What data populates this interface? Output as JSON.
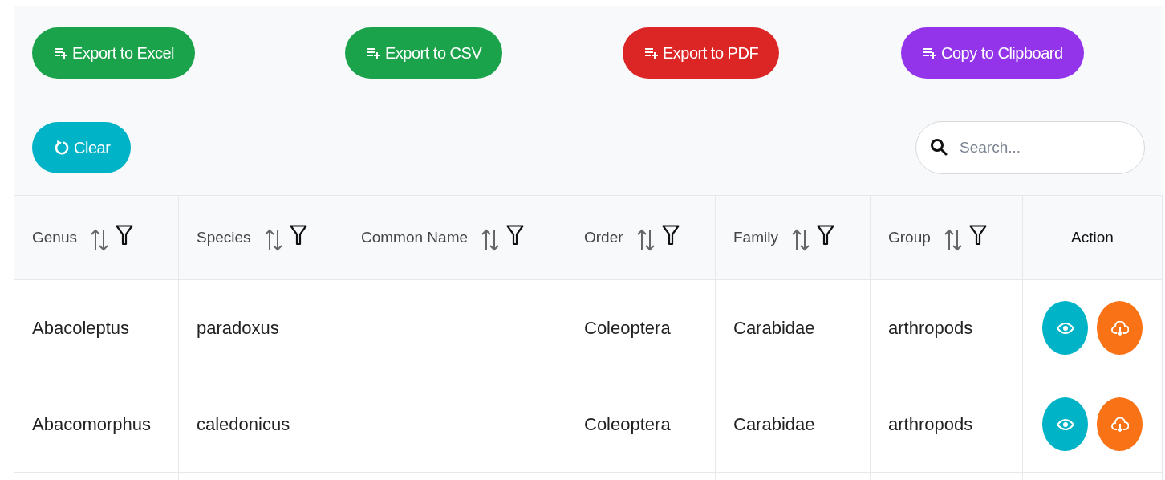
{
  "export_buttons": [
    {
      "label": "Export to Excel",
      "color": "#1aa34a"
    },
    {
      "label": "Export to CSV",
      "color": "#1aa34a"
    },
    {
      "label": "Export to PDF",
      "color": "#dc2626"
    },
    {
      "label": "Copy to Clipboard",
      "color": "#9333ea"
    }
  ],
  "clear_button": {
    "label": "Clear"
  },
  "search": {
    "placeholder": "Search..."
  },
  "table": {
    "columns": [
      {
        "label": "Genus",
        "kind": "sortable"
      },
      {
        "label": "Species",
        "kind": "sortable"
      },
      {
        "label": "Common Name",
        "kind": "sortable"
      },
      {
        "label": "Order",
        "kind": "sortable"
      },
      {
        "label": "Family",
        "kind": "sortable"
      },
      {
        "label": "Group",
        "kind": "sortable"
      },
      {
        "label": "Action",
        "kind": "action"
      }
    ],
    "rows": [
      {
        "cells": [
          "Abacoleptus",
          "paradoxus",
          "",
          "Coleoptera",
          "Carabidae",
          "arthropods"
        ],
        "actions": [
          {
            "kind": "view",
            "color": "#00b3c6"
          },
          {
            "kind": "download",
            "color": "#f97316"
          }
        ]
      },
      {
        "cells": [
          "Abacomorphus",
          "caledonicus",
          "",
          "Coleoptera",
          "Carabidae",
          "arthropods"
        ],
        "actions": [
          {
            "kind": "view",
            "color": "#00b3c6"
          },
          {
            "kind": "download",
            "color": "#f97316"
          }
        ]
      }
    ]
  }
}
